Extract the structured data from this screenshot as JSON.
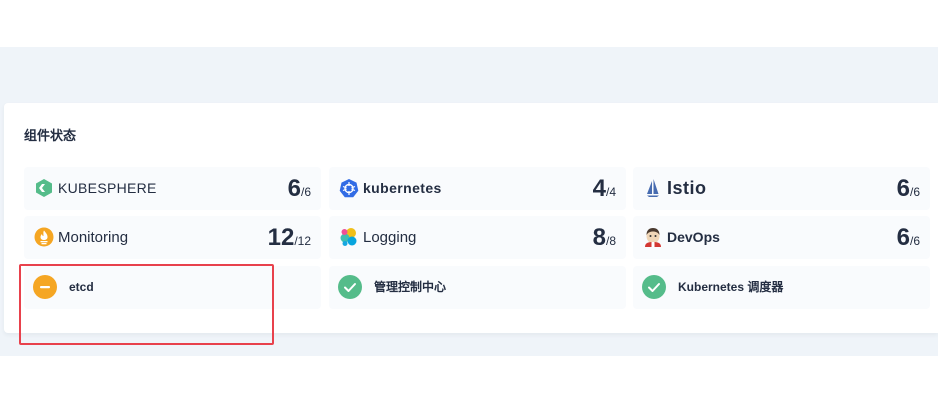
{
  "section": {
    "title": "组件状态"
  },
  "components": [
    {
      "name": "KUBESPHERE",
      "healthy": "6",
      "total": "/6",
      "logo": "kubesphere-logo-icon",
      "color": "#55bc8a"
    },
    {
      "name": "kubernetes",
      "healthy": "4",
      "total": "/4",
      "logo": "kubernetes-logo-icon",
      "color": "#326ce5"
    },
    {
      "name": "Istio",
      "healthy": "6",
      "total": "/6",
      "logo": "istio-logo-icon",
      "color": "#466bb0"
    },
    {
      "name": "Monitoring",
      "healthy": "12",
      "total": "/12",
      "logo": "monitoring-logo-icon",
      "color": "#f5a623"
    },
    {
      "name": "Logging",
      "healthy": "8",
      "total": "/8",
      "logo": "logging-logo-icon",
      "color": "#00bfb3"
    },
    {
      "name": "DevOps",
      "healthy": "6",
      "total": "/6",
      "logo": "devops-logo-icon",
      "color": "#d33833"
    }
  ],
  "services": [
    {
      "name": "etcd",
      "status": "warning",
      "icon": "minus-icon",
      "color": "#f5a623"
    },
    {
      "name": "管理控制中心",
      "status": "healthy",
      "icon": "check-icon",
      "color": "#55bc8a"
    },
    {
      "name": "Kubernetes 调度器",
      "status": "healthy",
      "icon": "check-icon",
      "color": "#55bc8a"
    }
  ],
  "highlight_color": "#e8414c"
}
